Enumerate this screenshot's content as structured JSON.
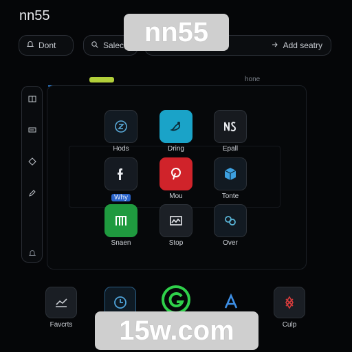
{
  "app_title": "nn55",
  "toolbar": {
    "dont_label": "Dont",
    "select_label": "Salec",
    "search_label": "Add seatry"
  },
  "watermarks": {
    "top": "nn55",
    "bottom": "15w.com"
  },
  "tabs": {
    "badge": "",
    "home_label": "hone"
  },
  "apps": [
    {
      "label": "Hods"
    },
    {
      "label": "Dring"
    },
    {
      "label": "Epall"
    },
    {
      "label": "",
      "badge": "Why"
    },
    {
      "label": "Mou"
    },
    {
      "label": "Tonte"
    },
    {
      "label": "Snaen"
    },
    {
      "label": "Stop"
    },
    {
      "label": "Over"
    }
  ],
  "dock": [
    {
      "label": "Favcrts"
    },
    {
      "label": ""
    },
    {
      "label": ""
    },
    {
      "label": ""
    },
    {
      "label": "Culp"
    }
  ],
  "colors": {
    "background": "#050608",
    "accent_blue": "#2a6fb8",
    "tab_badge": "#b2cf3a",
    "pinterest_red": "#d0232a",
    "green_app": "#1f9a3f",
    "teal_app": "#1aa3c8"
  },
  "icons": {
    "sidebar": [
      "book-icon",
      "card-icon",
      "diamond-icon",
      "pencil-icon",
      "bell-icon"
    ],
    "apps": [
      "clock-icon",
      "paint-icon",
      "ns-icon",
      "facebook-icon",
      "pinterest-icon",
      "cube-icon",
      "m-icon",
      "wave-icon",
      "link-icon"
    ],
    "dock": [
      "chart-icon",
      "timer-icon",
      "refresh-icon",
      "a-icon",
      "rune-icon"
    ]
  }
}
